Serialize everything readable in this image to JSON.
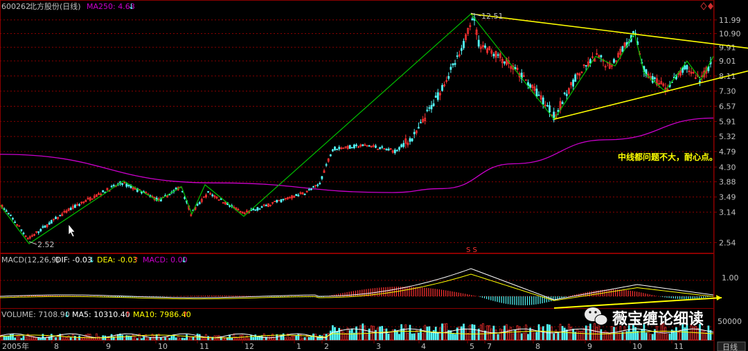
{
  "header": {
    "symbol": "600262",
    "name": "北方股份",
    "period_tag": "(日线)",
    "ma_label": "MA250: 4.68",
    "ma_arrow": "↓"
  },
  "colors": {
    "up": "#ff3232",
    "down": "#54fcfc",
    "zigzag": "#00c000",
    "trendline": "#ffff00",
    "ma250": "#cc00cc",
    "grid": "#8b0000",
    "axis_text": "#c0c0c0",
    "dif": "#ffffff",
    "dea": "#ffff00",
    "ma10": "#ffff00"
  },
  "price_axis": {
    "ticks": [
      "11.99",
      "10.90",
      "9.91",
      "9.01",
      "8.11",
      "7.30",
      "6.57",
      "5.91",
      "5.32",
      "4.79",
      "4.30",
      "3.88",
      "3.49",
      "3.14",
      "2.54"
    ],
    "scale": "log"
  },
  "annotations": {
    "high_label": "12.51",
    "low_label": "2.52",
    "comment": "中线都问题不大，耐心点。",
    "ss_mark": "S S"
  },
  "macd_panel": {
    "name": "MACD(12,26,9)",
    "dif_label": "DIF: -0.03",
    "dif_arrow": "↓",
    "dea_label": "DEA: -0.03",
    "dea_arrow": "↑",
    "macd_label": "MACD: 0.00",
    "macd_arrow": "↓",
    "tick": "1.00"
  },
  "volume_panel": {
    "volume_label": "VOLUME: 7108.90",
    "volume_arrow": "↓",
    "ma5_label": "MA5: 10310.40",
    "ma5_arrow": "↑",
    "ma10_label": "MA10: 7986.40",
    "ma10_arrow": "↑",
    "tick": "50000"
  },
  "time_axis": {
    "labels": [
      "2005年",
      "8",
      "9",
      "10",
      "11",
      "12",
      "1",
      "2",
      "3",
      "4",
      "5",
      "7",
      "8",
      "9",
      "10",
      "11"
    ],
    "period_button": "日线"
  },
  "watermark": "薇宝缠论细读",
  "chart_data": {
    "type": "candlestick",
    "title": "600262 北方股份(日线)",
    "y_scale": "log",
    "ylim": [
      2.4,
      12.9
    ],
    "x_months": [
      "2005-07",
      "2005-08",
      "2005-09",
      "2005-10",
      "2005-11",
      "2005-12",
      "2006-01",
      "2006-02",
      "2006-03",
      "2006-04",
      "2006-05",
      "2006-07",
      "2006-08",
      "2006-09",
      "2006-10",
      "2006-11"
    ],
    "zigzag": {
      "name": "笔",
      "points": [
        [
          "2005-07",
          3.3
        ],
        [
          "2005-07",
          2.52
        ],
        [
          "2005-09",
          3.9
        ],
        [
          "2005-10",
          3.4
        ],
        [
          "2005-11",
          3.75
        ],
        [
          "2005-11",
          3.1
        ],
        [
          "2005-11",
          3.8
        ],
        [
          "2005-12",
          3.05
        ],
        [
          "2006-05",
          12.51
        ],
        [
          "2006-08",
          6.0
        ],
        [
          "2006-09",
          9.3
        ],
        [
          "2006-09",
          8.7
        ],
        [
          "2006-10",
          10.95
        ],
        [
          "2006-10",
          8.3
        ],
        [
          "2006-10",
          7.3
        ],
        [
          "2006-11",
          9.0
        ],
        [
          "2006-11",
          7.9
        ],
        [
          "2006-11",
          9.3
        ]
      ]
    },
    "trendlines": [
      {
        "from": [
          "2006-05",
          12.51
        ],
        "to": [
          "2006-11",
          9.85
        ]
      },
      {
        "from": [
          "2006-08",
          6.0
        ],
        "to": [
          "2006-11",
          8.4
        ]
      }
    ],
    "ma250": {
      "last": 4.68,
      "shape": [
        [
          0,
          4.7
        ],
        [
          0.3,
          3.85
        ],
        [
          0.55,
          3.6
        ],
        [
          0.62,
          3.7
        ],
        [
          0.72,
          4.4
        ],
        [
          0.85,
          5.2
        ],
        [
          1,
          6.05
        ]
      ]
    },
    "macd": {
      "dif": -0.03,
      "dea": -0.03,
      "macd": 0.0
    },
    "volume": {
      "last": 7108.9,
      "ma5": 10310.4,
      "ma10": 7986.4
    }
  }
}
